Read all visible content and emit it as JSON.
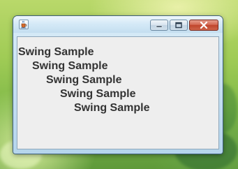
{
  "window": {
    "title": "",
    "icon": "java-cup-icon",
    "controls": {
      "minimize": "minimize-icon",
      "maximize": "maximize-icon",
      "close": "close-icon"
    }
  },
  "content": {
    "lines": [
      "Swing Sample",
      "Swing Sample",
      "Swing Sample",
      "Swing Sample",
      "Swing Sample"
    ]
  },
  "colors": {
    "text": "#333333",
    "client_background": "#eeeeee",
    "close_button": "#c0452c"
  }
}
